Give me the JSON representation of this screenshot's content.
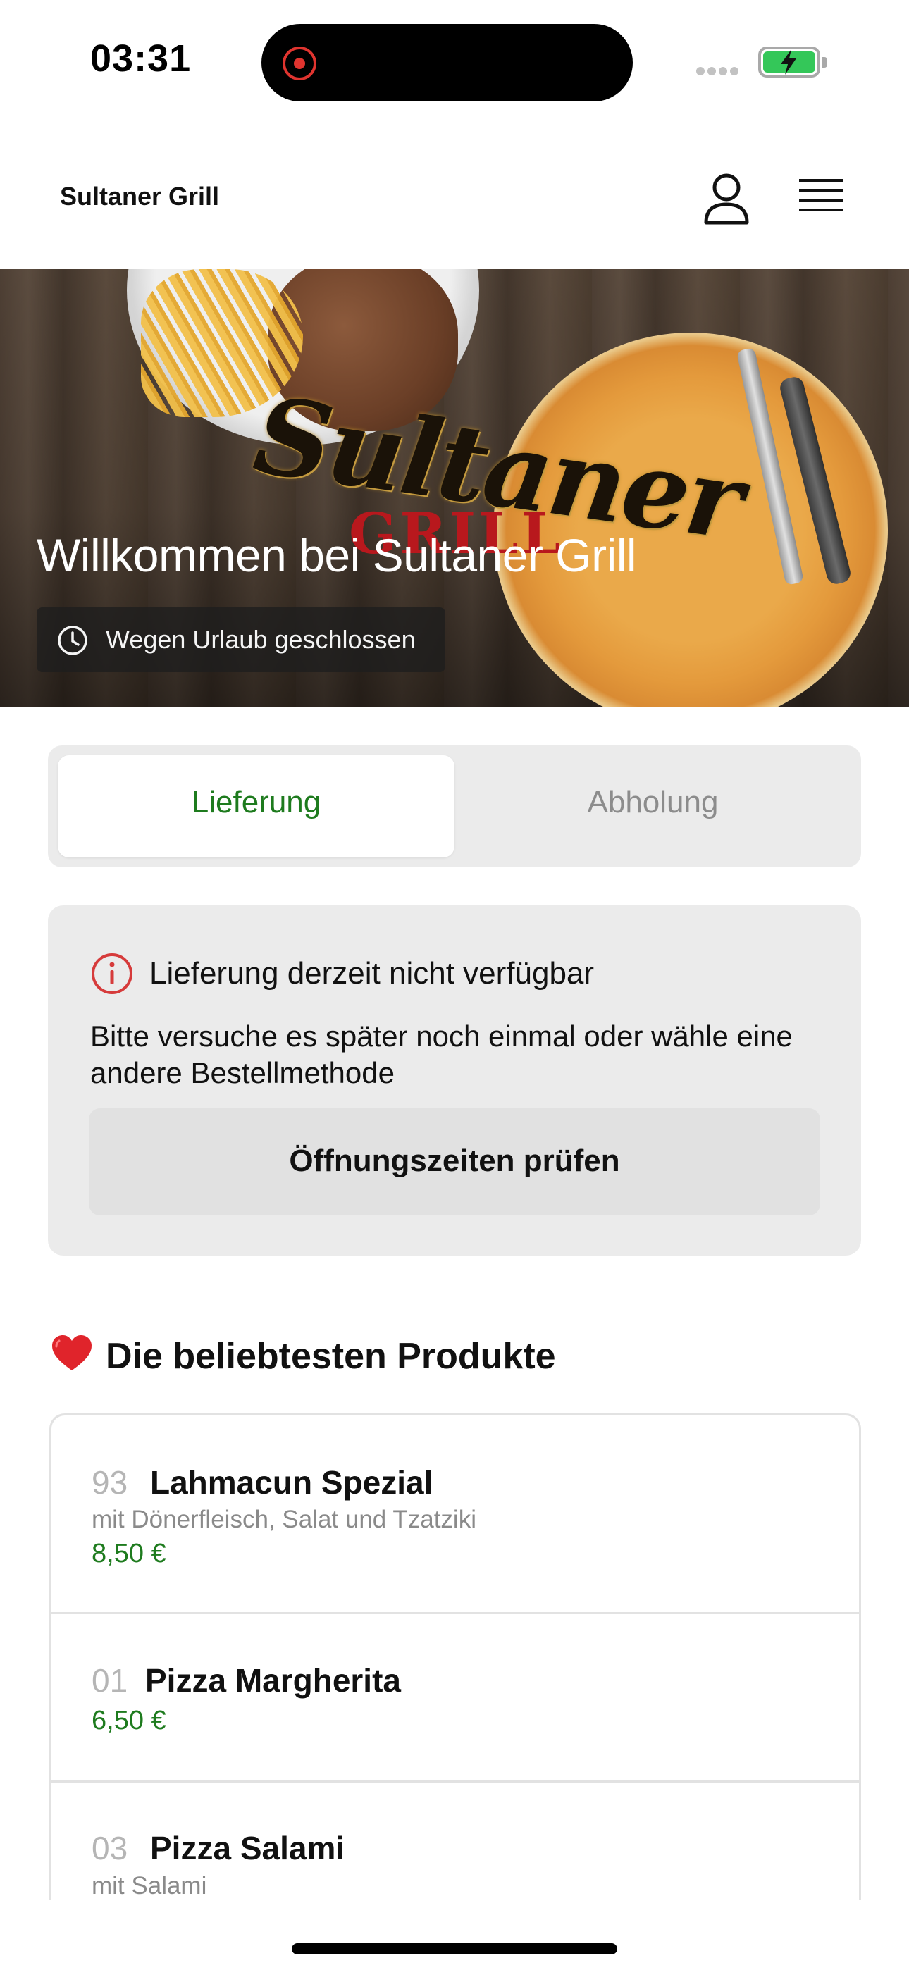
{
  "status_bar": {
    "time": "03:31"
  },
  "header": {
    "brand": "Sultaner Grill"
  },
  "hero": {
    "logo_main": "Sultaner",
    "logo_sub": "GRILL",
    "title": "Willkommen bei Sultaner Grill",
    "status_badge": "Wegen Urlaub geschlossen"
  },
  "order_mode": {
    "options": [
      "Lieferung",
      "Abholung"
    ],
    "selected": "Lieferung",
    "active_color": "#1e7b1e"
  },
  "notice": {
    "title": "Lieferung derzeit nicht verfügbar",
    "body": "Bitte versuche es später noch einmal oder wähle eine andere Bestellmethode",
    "button": "Öffnungszeiten prüfen",
    "icon": "info-icon",
    "icon_color": "#d63b3b"
  },
  "popular": {
    "heading": "Die beliebtesten Produkte",
    "heading_icon": "heart-icon",
    "products": [
      {
        "number": "93",
        "name": "Lahmacun Spezial",
        "description": "mit Dönerfleisch, Salat und Tzatziki",
        "price": "8,50 €"
      },
      {
        "number": "01",
        "name": "Pizza Margherita",
        "description": "",
        "price": "6,50 €"
      },
      {
        "number": "03",
        "name": "Pizza Salami",
        "description": "mit Salami",
        "price": ""
      }
    ]
  }
}
